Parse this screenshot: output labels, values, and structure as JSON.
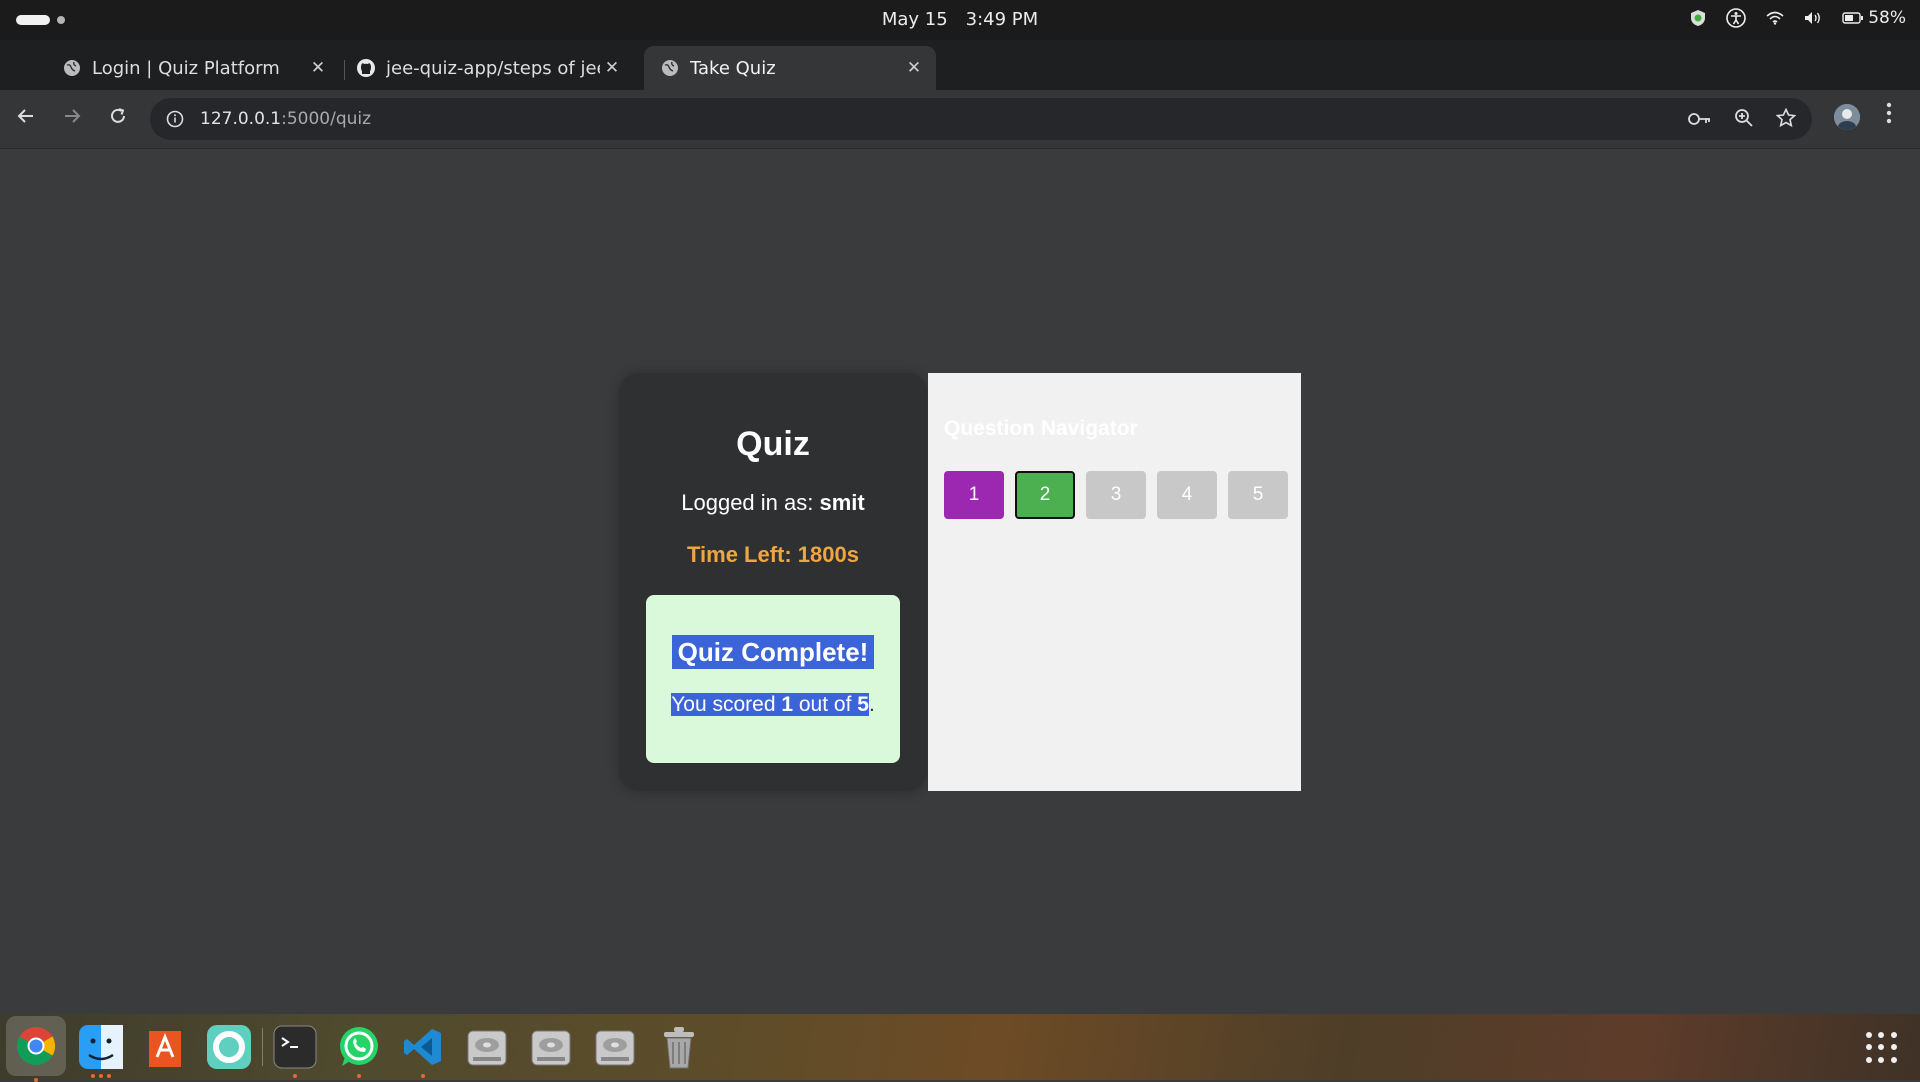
{
  "system_bar": {
    "date": "May 15",
    "time": "3:49 PM",
    "battery": "58%"
  },
  "tabs": [
    {
      "title": "Login | Quiz Platform",
      "active": false
    },
    {
      "title": "jee-quiz-app/steps of jee",
      "active": false
    },
    {
      "title": "Take Quiz",
      "active": true
    }
  ],
  "address_bar": {
    "host": "127.0.0.1",
    "path": ":5000/quiz"
  },
  "quiz": {
    "heading": "Quiz",
    "logged_in_prefix": "Logged in as: ",
    "username": "smit",
    "time_left": "Time Left: 1800s",
    "result_title": "Quiz Complete!",
    "score_prefix": "You scored ",
    "score": "1",
    "score_middle": " out of ",
    "total": "5",
    "score_suffix": "."
  },
  "navigator": {
    "title": "Question Navigator",
    "buttons": [
      {
        "label": "1",
        "state": "visited",
        "color": "#9c27b0"
      },
      {
        "label": "2",
        "state": "current",
        "color": "#4caf50"
      },
      {
        "label": "3",
        "state": "unvisited",
        "color": "#c8c8c8"
      },
      {
        "label": "4",
        "state": "unvisited",
        "color": "#c8c8c8"
      },
      {
        "label": "5",
        "state": "unvisited",
        "color": "#c8c8c8"
      }
    ]
  },
  "dock": {
    "apps": [
      "chrome-icon",
      "finder-icon",
      "app-center-icon",
      "help-icon",
      "terminal-icon",
      "whatsapp-icon",
      "vscode-icon",
      "drive-icon",
      "drive-icon",
      "drive-icon",
      "trash-icon"
    ]
  },
  "colors": {
    "page_bg": "#3a3b3d",
    "card_bg": "#2f3032",
    "timer": "#f0a640",
    "result_bg": "#daf9da",
    "selection": "#3a64d8"
  }
}
